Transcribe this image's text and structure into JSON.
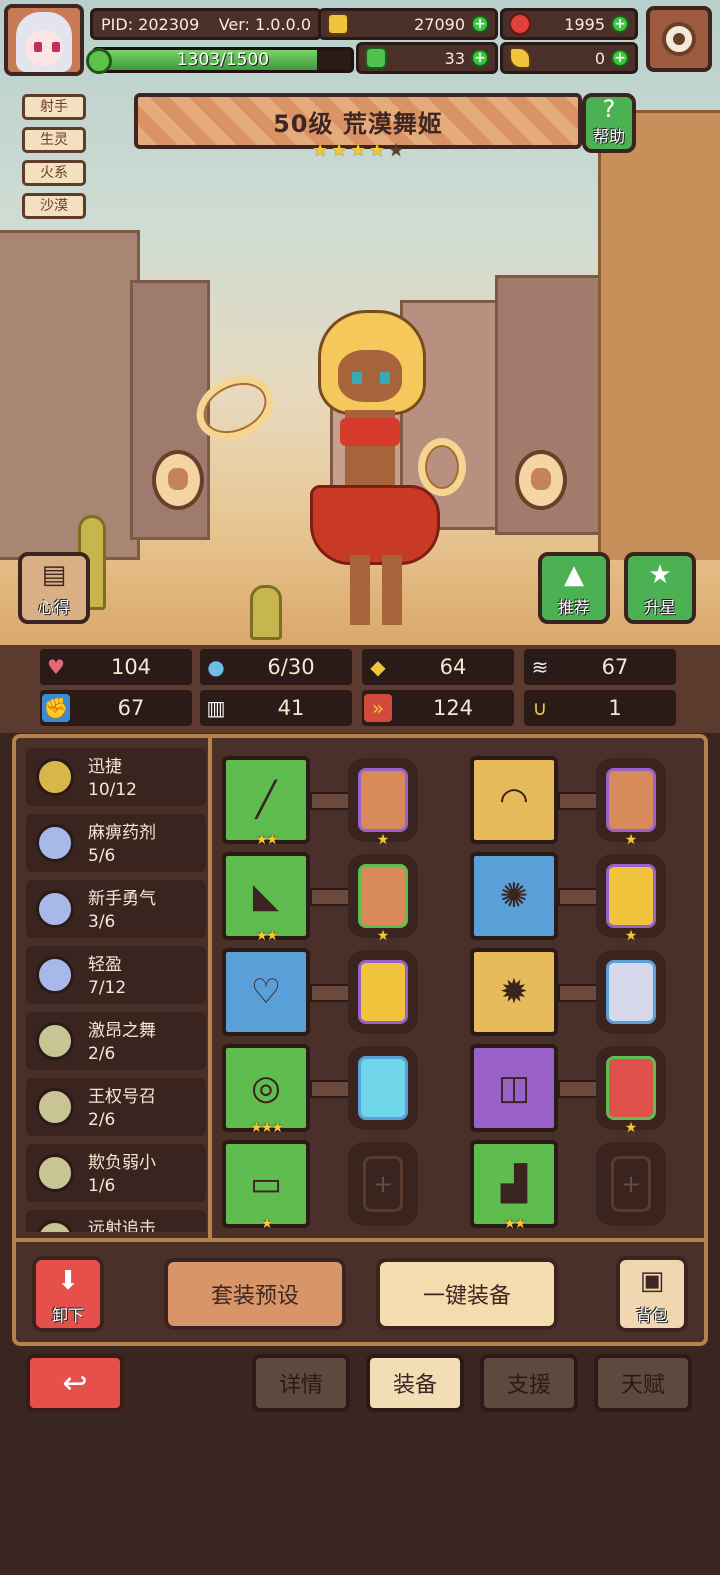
{
  "header": {
    "pid": "PID: 202309",
    "version": "Ver: 1.0.0.0",
    "gold": "27090",
    "gems": "1995",
    "clover": "33",
    "keys": "0",
    "xp_text": "1303/1500",
    "xp_fraction": 0.869
  },
  "hero": {
    "tags": [
      "射手",
      "生灵",
      "火系",
      "沙漠"
    ],
    "title": "50级 荒漠舞姬",
    "stars_filled": 4,
    "stars_total": 5,
    "help_label": "帮助",
    "notes_label": "心得",
    "recommend_label": "推荐",
    "upgrade_label": "升星"
  },
  "stats": [
    {
      "icon": "heart-icon",
      "value": "104"
    },
    {
      "icon": "water-drop-icon",
      "value": "6/30"
    },
    {
      "icon": "shield-icon",
      "value": "64"
    },
    {
      "icon": "wing-icon",
      "value": "67"
    },
    {
      "icon": "fist-icon",
      "value": "67"
    },
    {
      "icon": "book-icon",
      "value": "41"
    },
    {
      "icon": "speed-icon",
      "value": "124"
    },
    {
      "icon": "horseshoe-icon",
      "value": "1"
    }
  ],
  "sets": [
    {
      "name": "迅捷",
      "progress": "10/12",
      "color": "#d8b64a"
    },
    {
      "name": "麻痹药剂",
      "progress": "5/6",
      "color": "#a7b9e8"
    },
    {
      "name": "新手勇气",
      "progress": "3/6",
      "color": "#a7b9e8"
    },
    {
      "name": "轻盈",
      "progress": "7/12",
      "color": "#a7b9e8"
    },
    {
      "name": "激昂之舞",
      "progress": "2/6",
      "color": "#c8c494"
    },
    {
      "name": "王权号召",
      "progress": "2/6",
      "color": "#c8c494"
    },
    {
      "name": "欺负弱小",
      "progress": "1/6",
      "color": "#c8c494"
    },
    {
      "name": "远射追击",
      "progress": "",
      "color": "#c8c494"
    }
  ],
  "equipment": {
    "left": [
      {
        "item": "wand",
        "stars": "★★",
        "rune_stars": "★"
      },
      {
        "item": "leaf-blade",
        "stars": "★★",
        "rune_stars": "★"
      },
      {
        "item": "necklace",
        "stars": "",
        "rune_stars": ""
      },
      {
        "item": "coin-charm",
        "stars": "★★★",
        "rune_stars": ""
      },
      {
        "item": "ring-chest",
        "stars": "★",
        "rune_stars": ""
      }
    ],
    "right": [
      {
        "item": "tiara",
        "stars": "",
        "rune_stars": "★"
      },
      {
        "item": "beetle",
        "stars": "",
        "rune_stars": "★"
      },
      {
        "item": "sun-ring",
        "stars": "",
        "rune_stars": ""
      },
      {
        "item": "bracelet",
        "stars": "",
        "rune_stars": "★"
      },
      {
        "item": "boots",
        "stars": "★★",
        "rune_stars": ""
      }
    ]
  },
  "actions": {
    "unequip_label": "卸下",
    "preset_label": "套装预设",
    "auto_equip_label": "一键装备",
    "bag_label": "背包"
  },
  "nav": {
    "tabs": [
      "详情",
      "装备",
      "支援",
      "天赋"
    ],
    "active": "装备"
  }
}
